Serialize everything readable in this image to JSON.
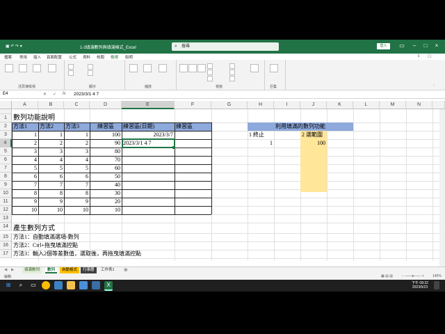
{
  "window": {
    "title": "1-3填滿數列與填滿格式_Excel",
    "search_placeholder": "搜尋",
    "signin_label": "登入"
  },
  "menu": [
    "檔案",
    "常用",
    "插入",
    "頁面配置",
    "公式",
    "資料",
    "校閱",
    "檢視",
    "說明"
  ],
  "active_menu": "檢視",
  "ribbon_groups": [
    "活頁簿檢視",
    "顯示",
    "縮放",
    "視窗",
    "巨集"
  ],
  "formula_bar": {
    "name_box": "E4",
    "fx": "fx",
    "content": "2023/3/1 4 7"
  },
  "columns": [
    "A",
    "B",
    "C",
    "D",
    "E",
    "F",
    "G",
    "H",
    "I",
    "J",
    "K",
    "L",
    "M",
    "N"
  ],
  "rows": [
    "1",
    "2",
    "3",
    "4",
    "5",
    "6",
    "7",
    "8",
    "9",
    "10",
    "11",
    "12",
    "13",
    "14",
    "15",
    "16",
    "17"
  ],
  "sheet": {
    "a1": "數列功能說明",
    "headers": [
      "方法1",
      "方法2",
      "方法3",
      "練習區",
      "練習區(日期)",
      "練習區"
    ],
    "table": [
      [
        "1",
        "1",
        "1",
        "100",
        "2023/3/7",
        ""
      ],
      [
        "2",
        "2",
        "2",
        "90",
        "2023/3/1 4 7",
        ""
      ],
      [
        "3",
        "3",
        "3",
        "80",
        "",
        ""
      ],
      [
        "4",
        "4",
        "4",
        "70",
        "",
        ""
      ],
      [
        "5",
        "5",
        "5",
        "60",
        "",
        ""
      ],
      [
        "6",
        "6",
        "6",
        "50",
        "",
        ""
      ],
      [
        "7",
        "7",
        "7",
        "40",
        "",
        ""
      ],
      [
        "8",
        "8",
        "8",
        "30",
        "",
        ""
      ],
      [
        "9",
        "9",
        "9",
        "20",
        "",
        ""
      ],
      [
        "10",
        "10",
        "10",
        "10",
        "",
        ""
      ]
    ],
    "fill_title": "利用填滿的數列功能",
    "h3": "1 終止",
    "j3": "2 選範圍",
    "h4": "1",
    "j4": "100",
    "a14": "產生數列方式",
    "a15": "方法1：自動填滿選項-數列",
    "a16": "方法2：Ctrl+拖曳填滿控點",
    "a17": "方法3：輸入2個等差數值，選取後，再拖曳填滿控點"
  },
  "tabs": [
    "填滿數列",
    "數列",
    "自動格式",
    "行事曆",
    "工作表1"
  ],
  "active_tab": "數列",
  "status": {
    "left": "編輯",
    "zoom": "145%"
  },
  "clock": {
    "time": "下午 08:32",
    "date": "2023/5/23"
  },
  "colors": {
    "excel_green": "#217346",
    "header_blue": "#8ea9db",
    "highlight_yellow": "#ffe699"
  }
}
